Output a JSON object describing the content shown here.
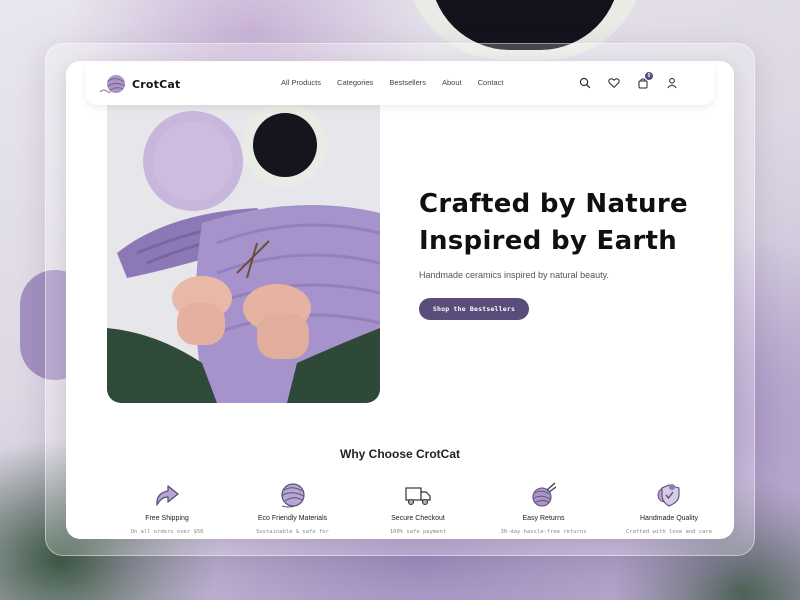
{
  "brand": {
    "name": "CrotCat"
  },
  "nav": {
    "links": [
      "All Products",
      "Categories",
      "Bestsellers",
      "About",
      "Contact"
    ],
    "cart_count": "0"
  },
  "hero": {
    "title_line1": "Crafted by Nature",
    "title_line2": "Inspired by Earth",
    "subtitle": "Handmade ceramics inspired by natural beauty.",
    "cta_label": "Shop the Bestsellers"
  },
  "why": {
    "heading": "Why Choose CrotCat",
    "features": [
      {
        "title": "Free Shipping",
        "desc": "On all orders over $50",
        "icon": "return-arrow-icon"
      },
      {
        "title": "Eco Friendly Materials",
        "desc": "Sustainable & safe for",
        "icon": "yarn-ball-icon"
      },
      {
        "title": "Secure Checkout",
        "desc": "100% safe payment",
        "icon": "delivery-truck-icon"
      },
      {
        "title": "Easy Returns",
        "desc": "30-day hassle-free returns",
        "icon": "yarn-needles-icon"
      },
      {
        "title": "Handmade Quality",
        "desc": "Crafted with love and care",
        "icon": "shield-check-icon"
      }
    ]
  },
  "colors": {
    "accent": "#5b4d7a",
    "lavender": "#b7a6d4",
    "text_dark": "#0f0f14"
  }
}
